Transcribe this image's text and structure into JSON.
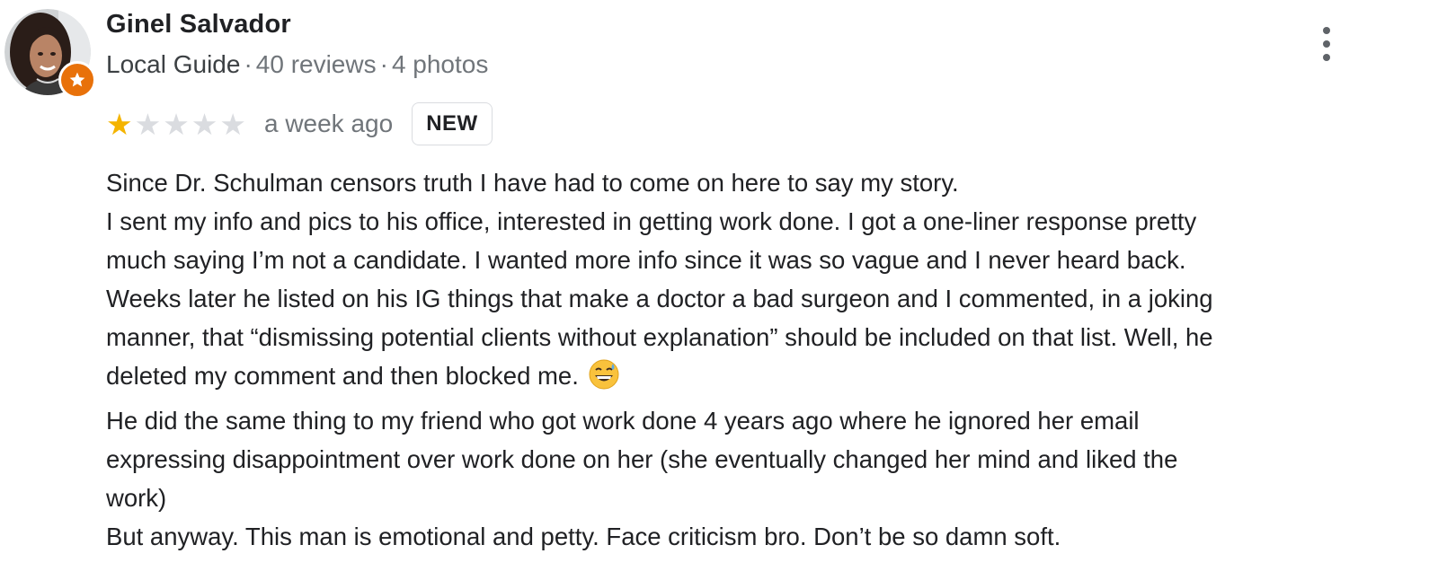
{
  "reviewer": {
    "name": "Ginel Salvador",
    "badge_icon": "local-guide-star-icon",
    "badge_color": "#e8710a",
    "meta": {
      "guide_label": "Local Guide",
      "separator": "·",
      "reviews": "40 reviews",
      "photos": "4 photos"
    }
  },
  "rating": {
    "stars": 1,
    "max_stars": 5,
    "star_color": "#f4b400",
    "time": "a week ago",
    "new_label": "NEW"
  },
  "more_options_icon": "more-vert-icon",
  "review_lines": [
    "Since Dr. Schulman censors truth I have had to come on here to say my story.",
    "I sent my info and pics to his office, interested in getting work done. I got a one-liner response pretty",
    "much saying I’m not a candidate. I wanted more info since it was so vague and I never heard back.",
    "Weeks later he listed on his IG things that make a doctor a bad surgeon and I commented, in a joking",
    "manner, that “dismissing potential clients without explanation” should be included on that list. Well, he",
    "deleted my comment and then blocked me.",
    "He did the same thing to my friend who got work done 4 years ago where he ignored her email",
    "expressing disappointment over work done on her (she eventually changed her mind and liked the",
    "work)",
    "But anyway. This man is emotional and petty. Face criticism bro. Don’t be so damn soft."
  ],
  "emoji_icon": "grinning-sweat-emoji-icon"
}
